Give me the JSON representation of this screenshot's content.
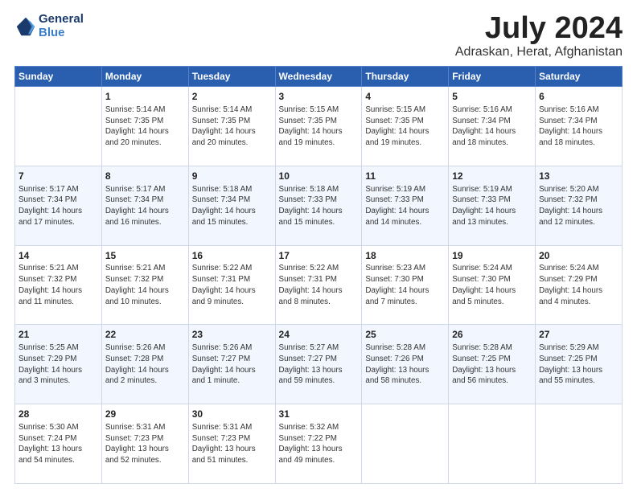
{
  "logo": {
    "line1": "General",
    "line2": "Blue"
  },
  "title": "July 2024",
  "location": "Adraskan, Herat, Afghanistan",
  "headers": [
    "Sunday",
    "Monday",
    "Tuesday",
    "Wednesday",
    "Thursday",
    "Friday",
    "Saturday"
  ],
  "weeks": [
    [
      {
        "day": "",
        "detail": ""
      },
      {
        "day": "1",
        "detail": "Sunrise: 5:14 AM\nSunset: 7:35 PM\nDaylight: 14 hours\nand 20 minutes."
      },
      {
        "day": "2",
        "detail": "Sunrise: 5:14 AM\nSunset: 7:35 PM\nDaylight: 14 hours\nand 20 minutes."
      },
      {
        "day": "3",
        "detail": "Sunrise: 5:15 AM\nSunset: 7:35 PM\nDaylight: 14 hours\nand 19 minutes."
      },
      {
        "day": "4",
        "detail": "Sunrise: 5:15 AM\nSunset: 7:35 PM\nDaylight: 14 hours\nand 19 minutes."
      },
      {
        "day": "5",
        "detail": "Sunrise: 5:16 AM\nSunset: 7:34 PM\nDaylight: 14 hours\nand 18 minutes."
      },
      {
        "day": "6",
        "detail": "Sunrise: 5:16 AM\nSunset: 7:34 PM\nDaylight: 14 hours\nand 18 minutes."
      }
    ],
    [
      {
        "day": "7",
        "detail": "Sunrise: 5:17 AM\nSunset: 7:34 PM\nDaylight: 14 hours\nand 17 minutes."
      },
      {
        "day": "8",
        "detail": "Sunrise: 5:17 AM\nSunset: 7:34 PM\nDaylight: 14 hours\nand 16 minutes."
      },
      {
        "day": "9",
        "detail": "Sunrise: 5:18 AM\nSunset: 7:34 PM\nDaylight: 14 hours\nand 15 minutes."
      },
      {
        "day": "10",
        "detail": "Sunrise: 5:18 AM\nSunset: 7:33 PM\nDaylight: 14 hours\nand 15 minutes."
      },
      {
        "day": "11",
        "detail": "Sunrise: 5:19 AM\nSunset: 7:33 PM\nDaylight: 14 hours\nand 14 minutes."
      },
      {
        "day": "12",
        "detail": "Sunrise: 5:19 AM\nSunset: 7:33 PM\nDaylight: 14 hours\nand 13 minutes."
      },
      {
        "day": "13",
        "detail": "Sunrise: 5:20 AM\nSunset: 7:32 PM\nDaylight: 14 hours\nand 12 minutes."
      }
    ],
    [
      {
        "day": "14",
        "detail": "Sunrise: 5:21 AM\nSunset: 7:32 PM\nDaylight: 14 hours\nand 11 minutes."
      },
      {
        "day": "15",
        "detail": "Sunrise: 5:21 AM\nSunset: 7:32 PM\nDaylight: 14 hours\nand 10 minutes."
      },
      {
        "day": "16",
        "detail": "Sunrise: 5:22 AM\nSunset: 7:31 PM\nDaylight: 14 hours\nand 9 minutes."
      },
      {
        "day": "17",
        "detail": "Sunrise: 5:22 AM\nSunset: 7:31 PM\nDaylight: 14 hours\nand 8 minutes."
      },
      {
        "day": "18",
        "detail": "Sunrise: 5:23 AM\nSunset: 7:30 PM\nDaylight: 14 hours\nand 7 minutes."
      },
      {
        "day": "19",
        "detail": "Sunrise: 5:24 AM\nSunset: 7:30 PM\nDaylight: 14 hours\nand 5 minutes."
      },
      {
        "day": "20",
        "detail": "Sunrise: 5:24 AM\nSunset: 7:29 PM\nDaylight: 14 hours\nand 4 minutes."
      }
    ],
    [
      {
        "day": "21",
        "detail": "Sunrise: 5:25 AM\nSunset: 7:29 PM\nDaylight: 14 hours\nand 3 minutes."
      },
      {
        "day": "22",
        "detail": "Sunrise: 5:26 AM\nSunset: 7:28 PM\nDaylight: 14 hours\nand 2 minutes."
      },
      {
        "day": "23",
        "detail": "Sunrise: 5:26 AM\nSunset: 7:27 PM\nDaylight: 14 hours\nand 1 minute."
      },
      {
        "day": "24",
        "detail": "Sunrise: 5:27 AM\nSunset: 7:27 PM\nDaylight: 13 hours\nand 59 minutes."
      },
      {
        "day": "25",
        "detail": "Sunrise: 5:28 AM\nSunset: 7:26 PM\nDaylight: 13 hours\nand 58 minutes."
      },
      {
        "day": "26",
        "detail": "Sunrise: 5:28 AM\nSunset: 7:25 PM\nDaylight: 13 hours\nand 56 minutes."
      },
      {
        "day": "27",
        "detail": "Sunrise: 5:29 AM\nSunset: 7:25 PM\nDaylight: 13 hours\nand 55 minutes."
      }
    ],
    [
      {
        "day": "28",
        "detail": "Sunrise: 5:30 AM\nSunset: 7:24 PM\nDaylight: 13 hours\nand 54 minutes."
      },
      {
        "day": "29",
        "detail": "Sunrise: 5:31 AM\nSunset: 7:23 PM\nDaylight: 13 hours\nand 52 minutes."
      },
      {
        "day": "30",
        "detail": "Sunrise: 5:31 AM\nSunset: 7:23 PM\nDaylight: 13 hours\nand 51 minutes."
      },
      {
        "day": "31",
        "detail": "Sunrise: 5:32 AM\nSunset: 7:22 PM\nDaylight: 13 hours\nand 49 minutes."
      },
      {
        "day": "",
        "detail": ""
      },
      {
        "day": "",
        "detail": ""
      },
      {
        "day": "",
        "detail": ""
      }
    ]
  ]
}
